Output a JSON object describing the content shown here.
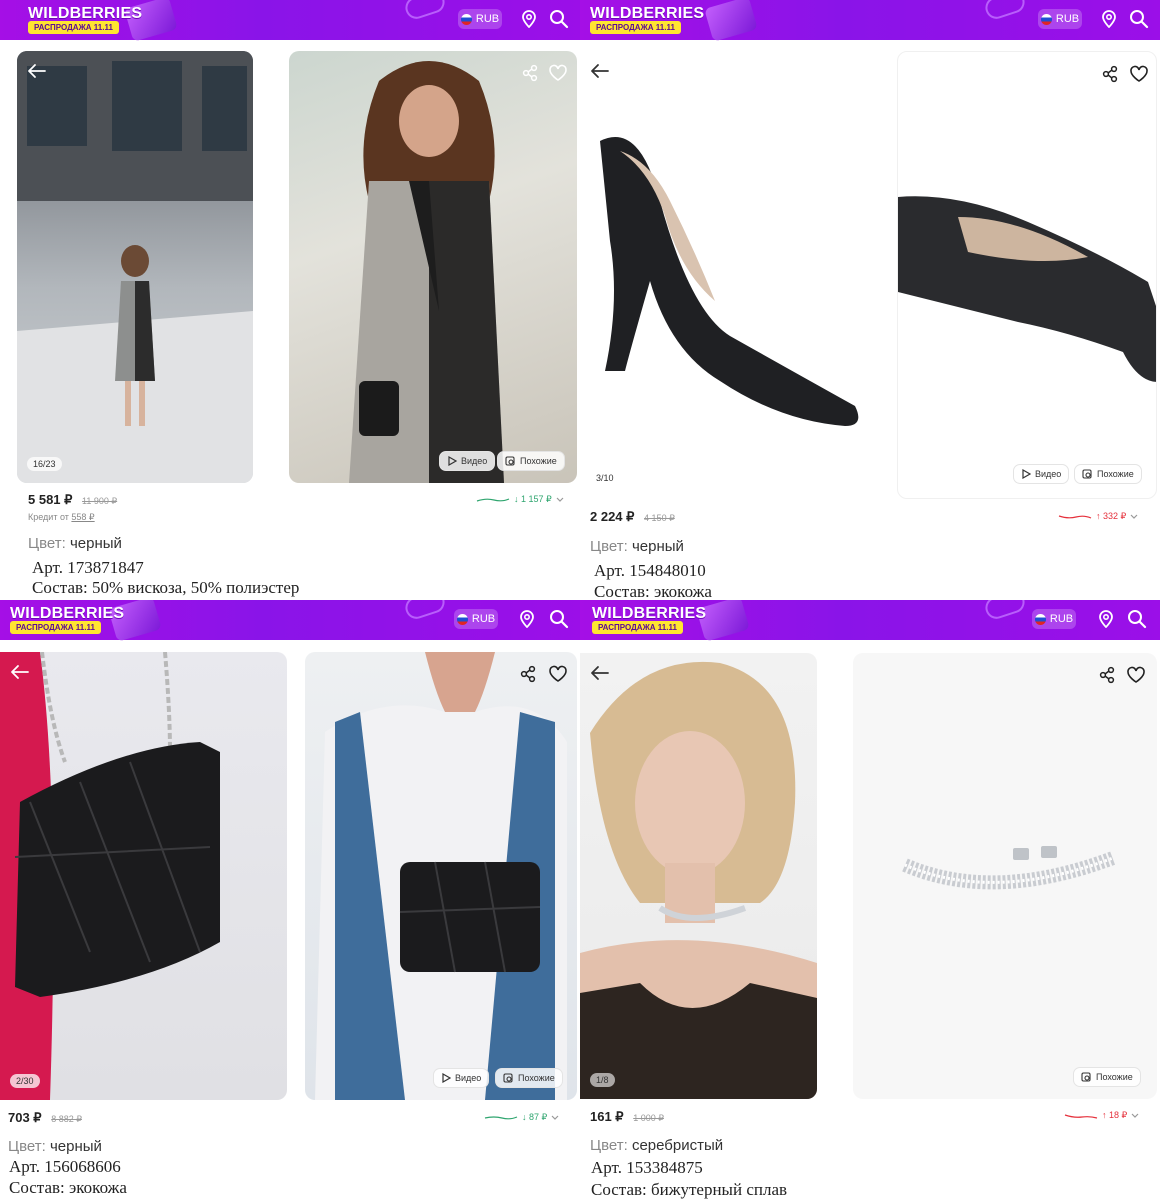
{
  "topbar": {
    "brand": "WILDBERRIES",
    "sale_badge": "РАСПРОДАЖА 11.11",
    "currency": "RUB",
    "accent_color": "#9a10e8"
  },
  "products": {
    "dress": {
      "photo_counter": "16/23",
      "video_label": "Видео",
      "similar_label": "Похожие",
      "price": "5 581 ₽",
      "old_price": "11 900 ₽",
      "credit_prefix": "Кредит от",
      "credit_value": "558 ₽",
      "trend": "↓ 1 157 ₽",
      "color_label": "Цвет:",
      "color_value": "черный",
      "article": "Арт. 173871847",
      "composition": "Состав: 50% вискоза, 50% полиэстер"
    },
    "shoes": {
      "photo_counter": "3/10",
      "video_label": "Видео",
      "similar_label": "Похожие",
      "price": "2 224 ₽",
      "old_price": "4 150 ₽",
      "trend": "↑ 332 ₽",
      "color_label": "Цвет:",
      "color_value": "черный",
      "article": "Арт. 154848010",
      "composition": "Состав: экокожа"
    },
    "bag": {
      "photo_counter": "2/30",
      "video_label": "Видео",
      "similar_label": "Похожие",
      "price": "703 ₽",
      "old_price": "8 882 ₽",
      "trend": "↓ 87 ₽",
      "color_label": "Цвет:",
      "color_value": "черный",
      "article": "Арт. 156068606",
      "composition": "Состав: экокожа"
    },
    "choker": {
      "photo_counter": "1/8",
      "similar_label": "Похожие",
      "price": "161 ₽",
      "old_price": "1 000 ₽",
      "trend": "↑ 18 ₽",
      "color_label": "Цвет:",
      "color_value": "серебристый",
      "article": "Арт. 153384875",
      "composition": "Состав: бижутерный сплав"
    }
  },
  "colors": {
    "trend_down": "#2fa56f",
    "trend_up": "#e5303b"
  }
}
